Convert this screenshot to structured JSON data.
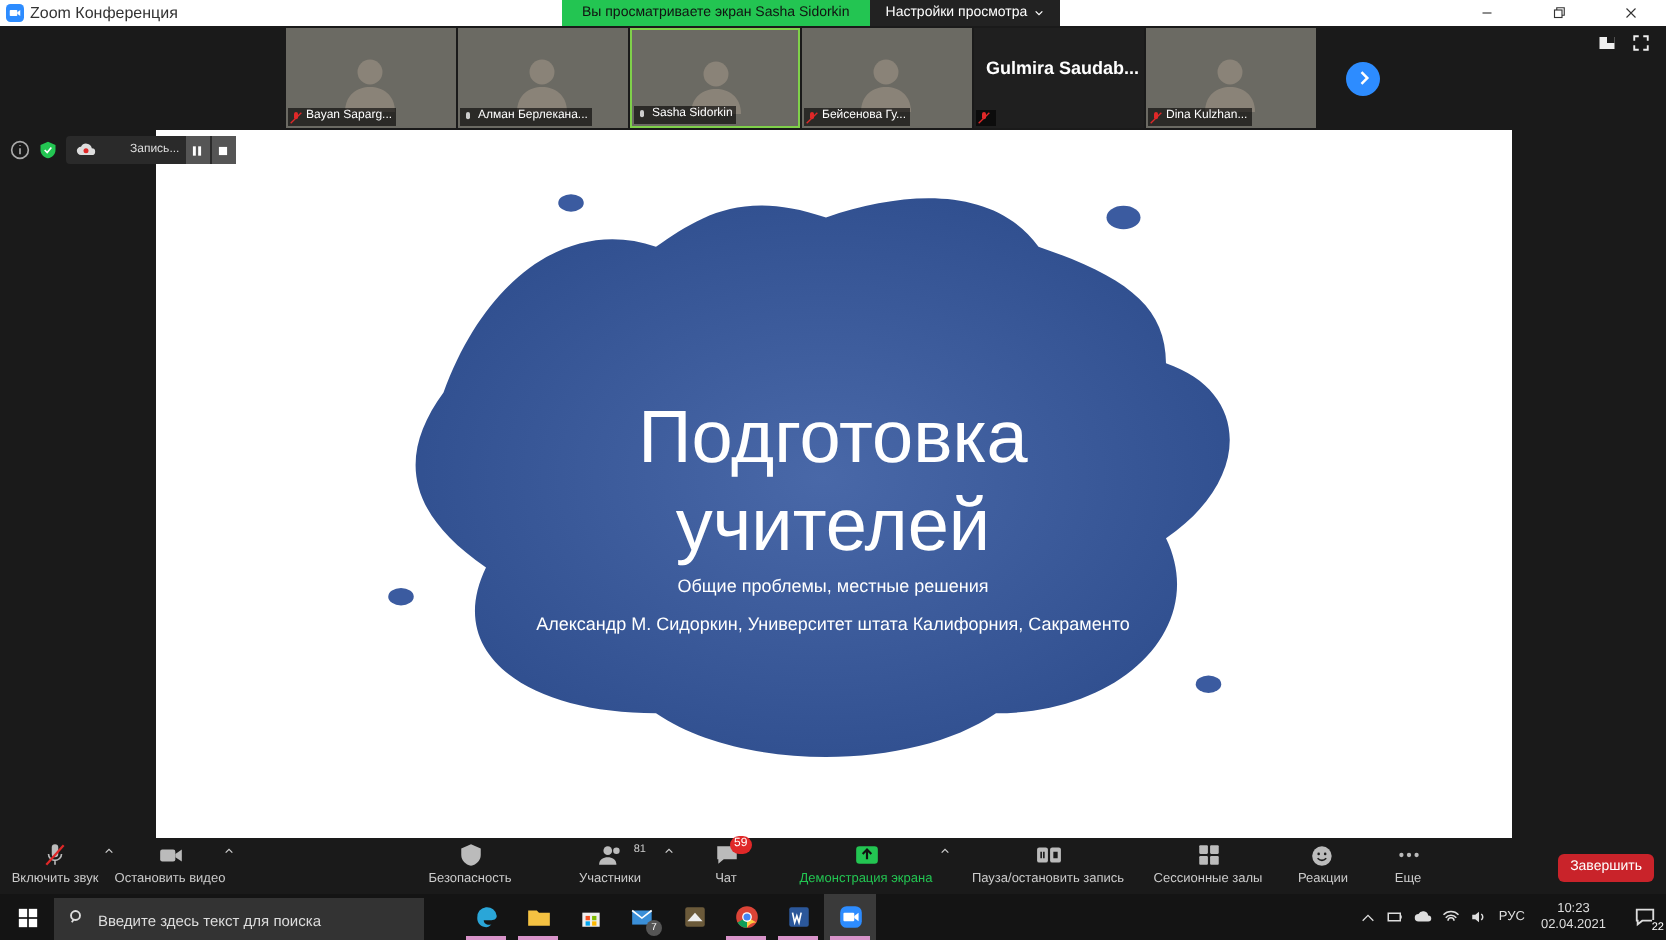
{
  "window": {
    "title": "Zoom Конференция"
  },
  "banner": {
    "text": "Вы просматриваете экран Sasha Sidorkin",
    "view_options": "Настройки просмотра"
  },
  "participants": [
    {
      "name": "Bayan Saparg...",
      "muted": true,
      "kind": "video"
    },
    {
      "name": "Алман Берлекана...",
      "muted": false,
      "kind": "video"
    },
    {
      "name": "Sasha Sidorkin",
      "muted": false,
      "kind": "video",
      "selected": true
    },
    {
      "name": "Бейсенова Гу...",
      "muted": true,
      "kind": "video"
    },
    {
      "name": "Gulmira Saudab...",
      "muted": true,
      "kind": "name"
    },
    {
      "name": "Dina Kulzhan...",
      "muted": true,
      "kind": "video"
    }
  ],
  "recording": {
    "label": "Запись..."
  },
  "slide": {
    "title": "Подготовка учителей",
    "subtitle": "Общие проблемы, местные решения",
    "author": "Александр М. Сидоркин, Университет штата Калифорния, Сакраменто"
  },
  "toolbar": [
    {
      "kind": "mic",
      "label": "Включить звук",
      "muted": true
    },
    {
      "kind": "video",
      "label": "Остановить видео"
    },
    {
      "kind": "security",
      "label": "Безопасность"
    },
    {
      "kind": "participants",
      "label": "Участники",
      "count": "81"
    },
    {
      "kind": "chat",
      "label": "Чат",
      "badge": "59"
    },
    {
      "kind": "share",
      "label": "Демонстрация экрана"
    },
    {
      "kind": "record",
      "label": "Пауза/остановить запись"
    },
    {
      "kind": "rooms",
      "label": "Сессионные залы"
    },
    {
      "kind": "reactions",
      "label": "Реакции"
    },
    {
      "kind": "more",
      "label": "Еще"
    }
  ],
  "end_button": "Завершить",
  "taskbar": {
    "search_placeholder": "Введите здесь текст для поиска",
    "mail_badge": "7",
    "language": "РУС",
    "time": "10:23",
    "date": "02.04.2021",
    "notifications": "22"
  }
}
